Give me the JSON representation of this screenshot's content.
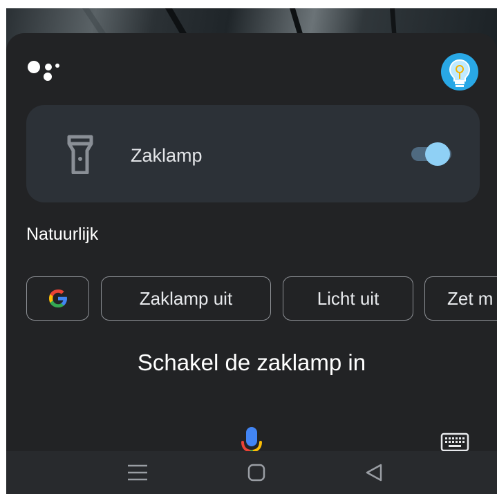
{
  "header": {
    "logo_icon": "google-assistant-icon",
    "avatar_icon": "lightbulb-avatar-icon"
  },
  "device_card": {
    "icon": "flashlight-icon",
    "label": "Zaklamp",
    "toggle_on": true
  },
  "section": {
    "title": "Natuurlijk"
  },
  "suggestions": [
    {
      "icon": "google-g-icon",
      "label": ""
    },
    {
      "label": "Zaklamp uit"
    },
    {
      "label": "Licht uit"
    },
    {
      "label": "Zet m"
    }
  ],
  "transcript": "Schakel de zaklamp in",
  "input_bar": {
    "mic_icon": "microphone-icon",
    "keyboard_icon": "keyboard-icon"
  },
  "navigation": {
    "items": [
      "menu-icon",
      "home-icon",
      "back-icon"
    ]
  },
  "colors": {
    "background": "#222325",
    "card": "#2c3137",
    "toggle_thumb": "#8fd0f5",
    "avatar": "#29a8e6"
  }
}
